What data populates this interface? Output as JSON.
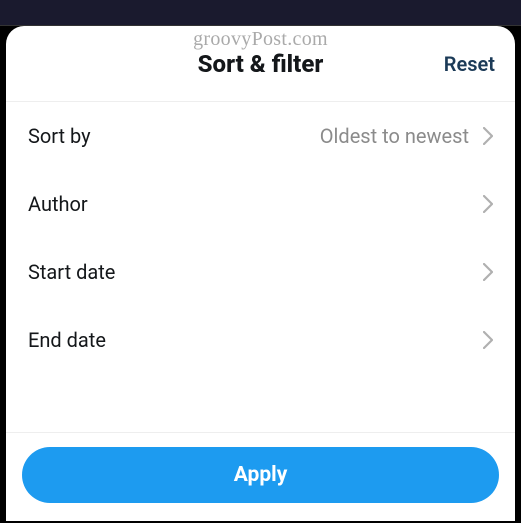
{
  "watermark": "groovyPost.com",
  "header": {
    "title": "Sort & filter",
    "reset_label": "Reset"
  },
  "rows": {
    "sort_by": {
      "label": "Sort by",
      "value": "Oldest to newest"
    },
    "author": {
      "label": "Author",
      "value": ""
    },
    "start_date": {
      "label": "Start date",
      "value": ""
    },
    "end_date": {
      "label": "End date",
      "value": ""
    }
  },
  "footer": {
    "apply_label": "Apply"
  }
}
